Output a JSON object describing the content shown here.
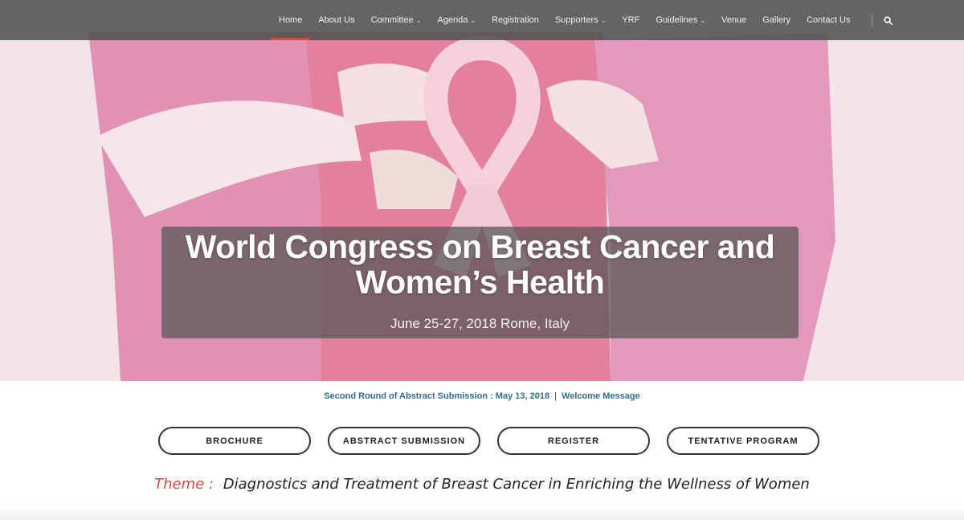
{
  "nav": {
    "items": [
      {
        "label": "Home",
        "active": true,
        "dropdown": false
      },
      {
        "label": "About Us",
        "dropdown": false
      },
      {
        "label": "Committee",
        "dropdown": true
      },
      {
        "label": "Agenda",
        "dropdown": true
      },
      {
        "label": "Registration",
        "dropdown": false
      },
      {
        "label": "Supporters",
        "dropdown": true
      },
      {
        "label": "YRF",
        "dropdown": false
      },
      {
        "label": "Guidelines",
        "dropdown": true
      },
      {
        "label": "Venue",
        "dropdown": false
      },
      {
        "label": "Gallery",
        "dropdown": false
      },
      {
        "label": "Contact Us",
        "dropdown": false
      }
    ],
    "search_icon": "search-icon"
  },
  "hero": {
    "title_line1": "World Congress on Breast Cancer and",
    "title_line2": "Women’s Health",
    "date_location": "June 25-27, 2018 Rome, Italy"
  },
  "announcement": {
    "left": "Second Round of Abstract Submission : May 13, 2018",
    "separator": "|",
    "right": "Welcome Message"
  },
  "buttons": {
    "brochure": "BROCHURE",
    "abstract": "ABSTRACT SUBMISSION",
    "register": "REGISTER",
    "program": "TENTATIVE PROGRAM"
  },
  "theme": {
    "label": "Theme :",
    "text": "Diagnostics and Treatment of Breast Cancer in Enriching the Wellness of Women"
  },
  "colors": {
    "accent": "#e0473e",
    "link": "#2b6f97",
    "nav_bg": "#525252"
  }
}
